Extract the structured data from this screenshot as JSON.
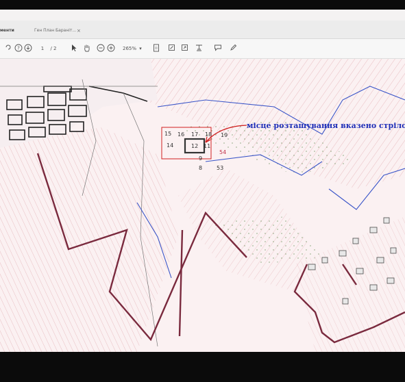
{
  "tabs": {
    "documents_label": "менти",
    "file_label": "Ген План Бараніт...",
    "close_glyph": "×"
  },
  "toolbar": {
    "page_current": "1",
    "page_total": "/ 2",
    "zoom": "265%"
  },
  "annotation": {
    "text": "місце  розташування вказено стрілочко"
  },
  "parcels": [
    "15",
    "16",
    "17",
    "18",
    "19",
    "14",
    "12",
    "11",
    "54",
    "9",
    "8",
    "53"
  ],
  "icons": [
    "undo-icon",
    "help-icon",
    "download-icon",
    "cursor-icon",
    "hand-icon",
    "zoom-out-icon",
    "zoom-in-icon",
    "fit-page-icon",
    "crop-icon",
    "fullscreen-icon",
    "stamp-icon",
    "comment-icon",
    "pen-icon"
  ]
}
